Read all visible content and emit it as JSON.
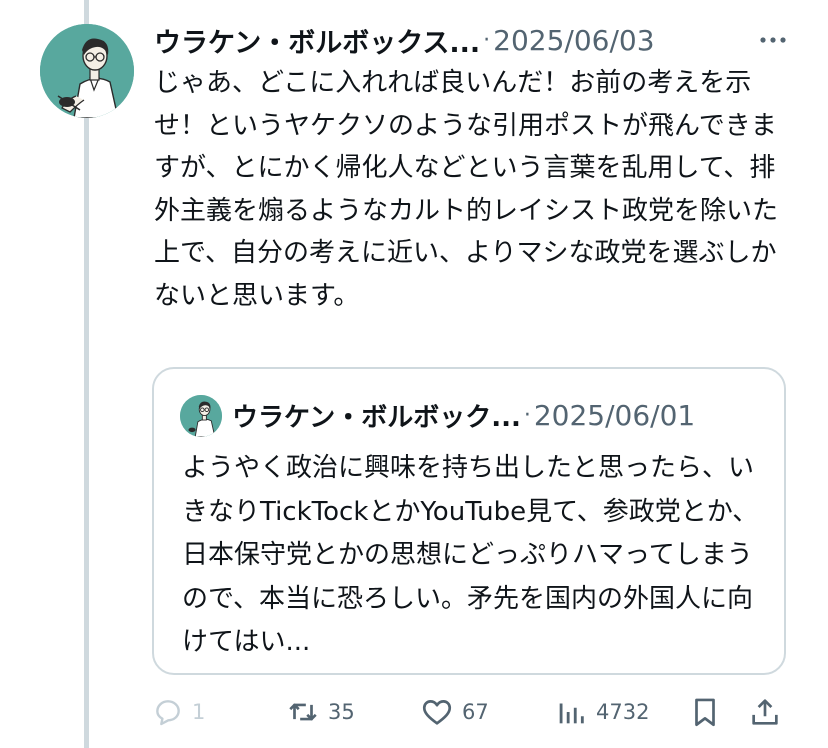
{
  "post": {
    "author": "ウラケン・ボルボックス...",
    "separator": "·",
    "date": "2025/06/03",
    "body": "じゃあ、どこに入れれば良いんだ！お前の考えを示せ！というヤケクソのような引用ポストが飛んできますが、とにかく帰化人などという言葉を乱用して、排外主義を煽るようなカルト的レイシスト政党を除いた上で、自分の考えに近い、よりマシな政党を選ぶしかないと思います。"
  },
  "quoted": {
    "author": "ウラケン・ボルボック...",
    "separator": "·",
    "date": "2025/06/01",
    "body": "ようやく政治に興味を持ち出したと思ったら、いきなりTickTockとかYouTube見て、参政党とか、日本保守党とかの思想にどっぷりハマってしまうので、本当に恐ろしい。矛先を国内の外国人に向けてはい..."
  },
  "actions": {
    "reply_count": "1",
    "repost_count": "35",
    "like_count": "67",
    "views_count": "4732"
  },
  "icons": {
    "more": "more-horizontal-icon",
    "reply": "reply-icon",
    "repost": "repost-icon",
    "like": "heart-icon",
    "views": "views-chart-icon",
    "bookmark": "bookmark-icon",
    "share": "share-icon"
  },
  "colors": {
    "avatar_bg": "#58a89e",
    "text_primary": "#0f1419",
    "text_secondary": "#536471",
    "border": "#cfd9de"
  }
}
